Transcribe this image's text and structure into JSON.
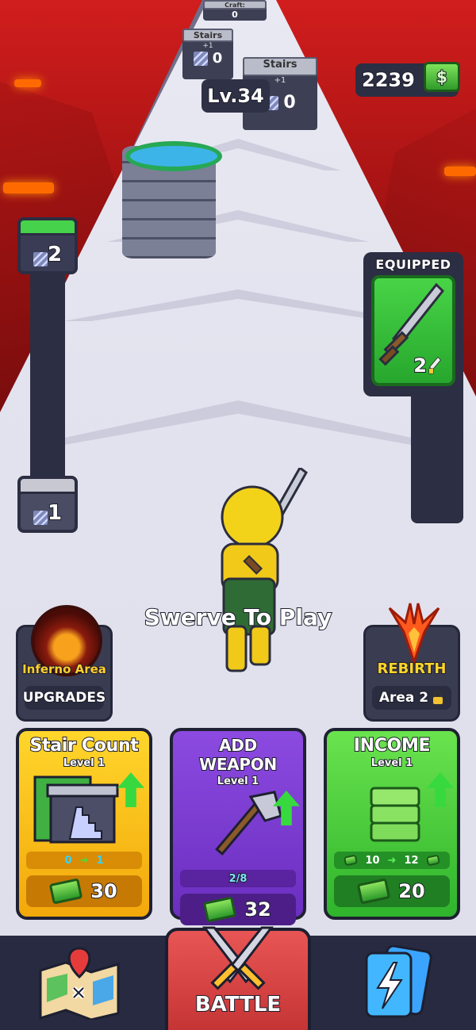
{
  "hud": {
    "cash": "2239",
    "level": "Lv.34"
  },
  "gates": [
    {
      "title": "Stairs",
      "bonus": "+1",
      "value": "0"
    },
    {
      "title": "Stairs",
      "bonus": "+1",
      "value": "0"
    },
    {
      "title": "Stairs",
      "bonus": "+1",
      "value": "0"
    },
    {
      "title": "Craft:",
      "bonus": "",
      "value": "0"
    }
  ],
  "stair_progress": {
    "top_value": "2",
    "bottom_value": "1"
  },
  "equipped": {
    "title": "EQUIPPED",
    "count": "2"
  },
  "prompt": "Swerve To Play",
  "side_buttons": {
    "area": {
      "title": "Inferno Area",
      "label": "UPGRADES"
    },
    "rebirth": {
      "title": "REBIRTH",
      "label": "Area 2"
    }
  },
  "cards": [
    {
      "title": "Stair Count",
      "level": "Level 1",
      "from": "0",
      "to": "1",
      "cost": "30"
    },
    {
      "title": "ADD WEAPON",
      "level": "Level 1",
      "progress": "2/8",
      "cost": "32"
    },
    {
      "title": "INCOME",
      "level": "Level 1",
      "from": "10",
      "to": "12",
      "cost": "20"
    }
  ],
  "nav": {
    "battle_label": "BATTLE"
  },
  "icons": {
    "map": "map-icon",
    "battle": "crossed-swords-icon",
    "cards": "lightning-cards-icon",
    "lock": "lock-icon",
    "cash": "cash-icon"
  }
}
